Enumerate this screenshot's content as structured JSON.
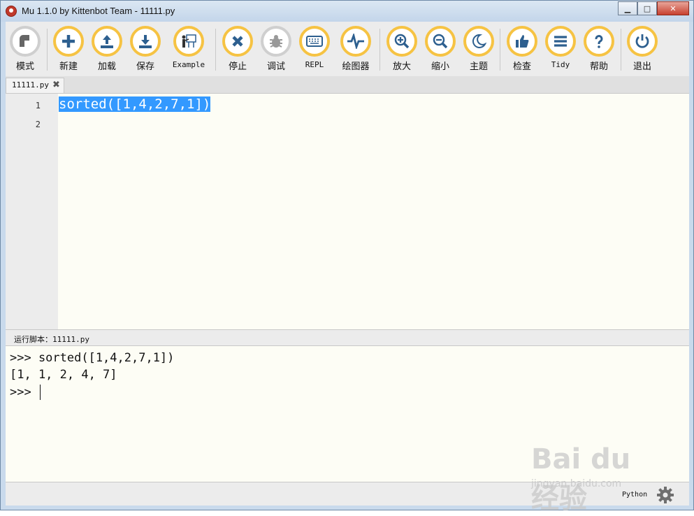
{
  "window": {
    "title": "Mu 1.1.0 by Kittenbot Team - 11111.py",
    "minimize": "▁",
    "maximize": "□",
    "close": "✕"
  },
  "toolbar": [
    {
      "label": "模式",
      "icon": "mode-icon"
    },
    {
      "label": "新建",
      "icon": "plus-icon"
    },
    {
      "label": "加载",
      "icon": "upload-icon"
    },
    {
      "label": "保存",
      "icon": "download-icon"
    },
    {
      "label": "Example",
      "icon": "presentation-icon"
    },
    {
      "label": "停止",
      "icon": "x-icon"
    },
    {
      "label": "调试",
      "icon": "bug-icon"
    },
    {
      "label": "REPL",
      "icon": "keyboard-icon"
    },
    {
      "label": "绘图器",
      "icon": "pulse-icon"
    },
    {
      "label": "放大",
      "icon": "zoom-in-icon"
    },
    {
      "label": "缩小",
      "icon": "zoom-out-icon"
    },
    {
      "label": "主题",
      "icon": "moon-icon"
    },
    {
      "label": "检查",
      "icon": "thumbs-up-icon"
    },
    {
      "label": "Tidy",
      "icon": "lines-icon"
    },
    {
      "label": "帮助",
      "icon": "question-icon"
    },
    {
      "label": "退出",
      "icon": "power-icon"
    }
  ],
  "tab": {
    "filename": "11111.py",
    "close": "✖"
  },
  "editor": {
    "line_numbers": [
      "1",
      "2"
    ],
    "lines": [
      "sorted([1,4,2,7,1])",
      ""
    ]
  },
  "run_label": {
    "prefix": "运行脚本：",
    "file": "11111.py"
  },
  "repl": {
    "lines": [
      ">>> sorted([1,4,2,7,1])",
      "[1, 1, 2, 4, 7]",
      ">>> "
    ]
  },
  "status": {
    "mode": "Python"
  },
  "watermark": {
    "text": "Bai du 经验",
    "url": "jingyan.baidu.com"
  },
  "colors": {
    "accent": "#f6c343",
    "icon": "#2d5f8f",
    "selection": "#3399ff",
    "editor_bg": "#fdfdf5"
  }
}
